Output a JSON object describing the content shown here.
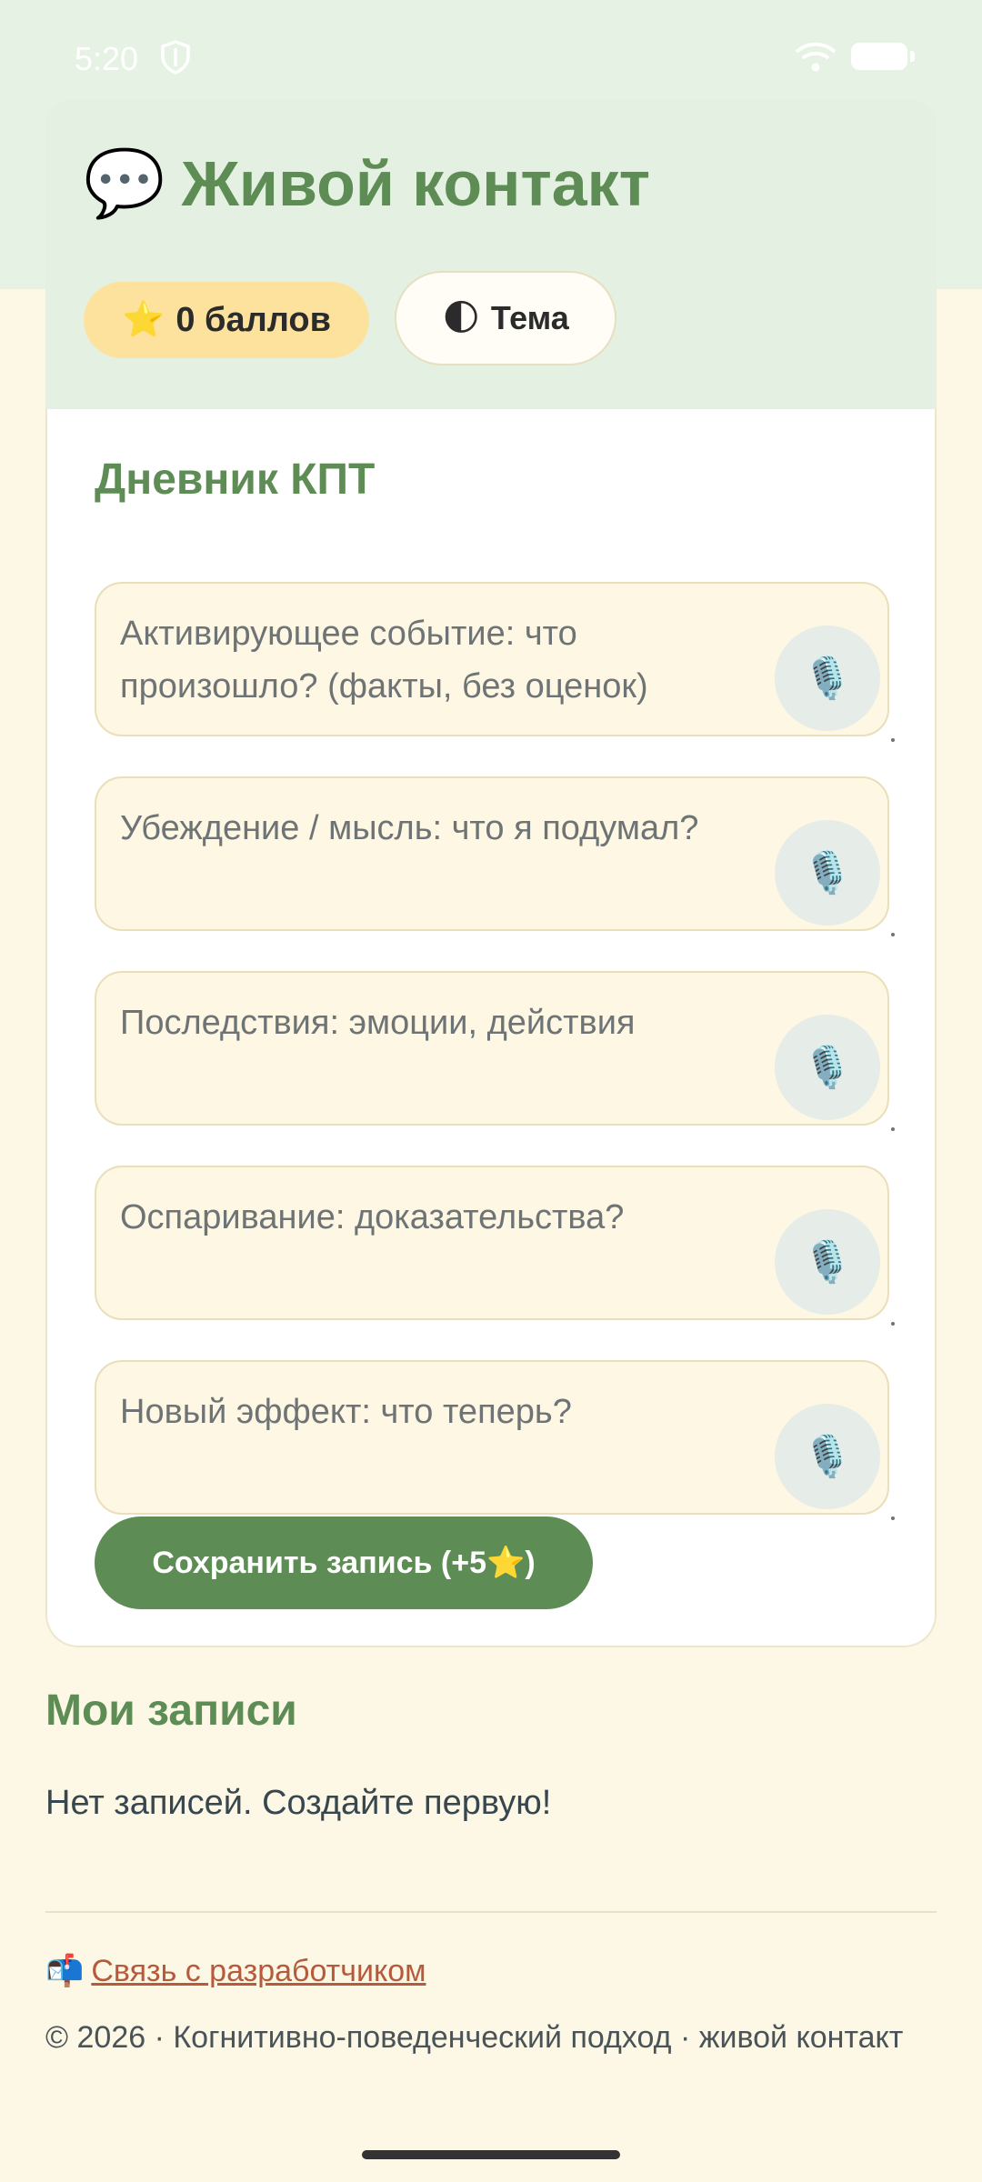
{
  "status_bar": {
    "time": "5:20"
  },
  "header": {
    "title_icon": "💬",
    "title": "Живой контакт",
    "points_icon": "⭐",
    "points_label": "0 баллов",
    "theme_icon": "🌓",
    "theme_label": "Тема"
  },
  "diary": {
    "title": "Дневник КПТ",
    "fields": [
      {
        "placeholder": "Активирующее событие: что произошло? (факты, без оценок)"
      },
      {
        "placeholder": "Убеждение / мысль: что я подумал?"
      },
      {
        "placeholder": "Последствия: эмоции, действия"
      },
      {
        "placeholder": "Оспаривание: доказательства?"
      },
      {
        "placeholder": "Новый эффект: что теперь?"
      }
    ],
    "mic_icon": "🎙️",
    "save_label": "Сохранить запись (+5⭐)"
  },
  "records": {
    "title": "Мои записи",
    "empty_text": "Нет записей. Создайте первую!"
  },
  "footer": {
    "contact_icon": "📬",
    "contact_label": "Связь с разработчиком",
    "copyright": "© 2026 · Когнитивно-поведенческий подход · живой контакт"
  }
}
